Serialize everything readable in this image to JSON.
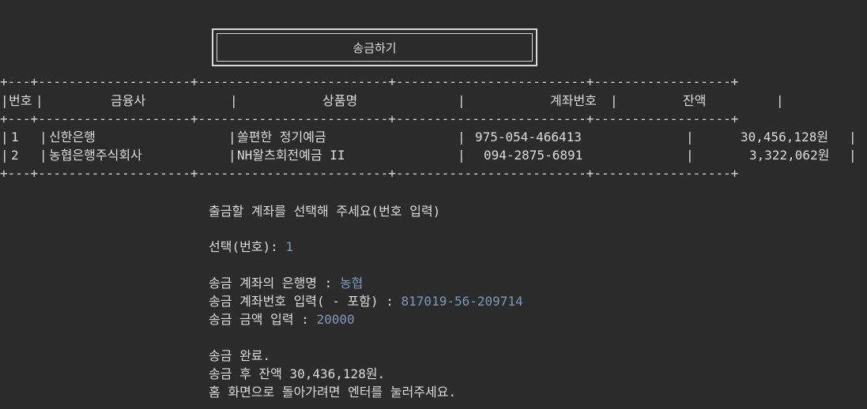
{
  "title": "송금하기",
  "table": {
    "headers": {
      "no": "번호",
      "bank": "금융사",
      "product": "상품명",
      "account": "계좌번호",
      "balance": "잔액"
    },
    "rows": [
      {
        "no": "1",
        "bank": "신한은행",
        "product": "쏠편한 정기예금",
        "account": "975-054-466413",
        "balance": "30,456,128원"
      },
      {
        "no": "2",
        "bank": "농협은행주식회사",
        "product": "NH왈츠회전예금 II",
        "account": "094-2875-6891",
        "balance": "3,322,062원"
      }
    ]
  },
  "prompt": {
    "select_account": "출금할 계좌를 선택해 주세요(번호 입력)",
    "select_label": "선택(번호): ",
    "select_value": "1",
    "bank_label": "송금 계좌의 은행명 : ",
    "bank_value": "농협",
    "account_label": "송금 계좌번호 입력( - 포함) : ",
    "account_value": "817019-56-209714",
    "amount_label": "송금 금액 입력 : ",
    "amount_value": "20000",
    "done": "송금 완료.",
    "after_balance": "송금 후 잔액 30,436,128원.",
    "go_home": "홈 화면으로 돌아가려면 엔터를 눌러주세요."
  }
}
